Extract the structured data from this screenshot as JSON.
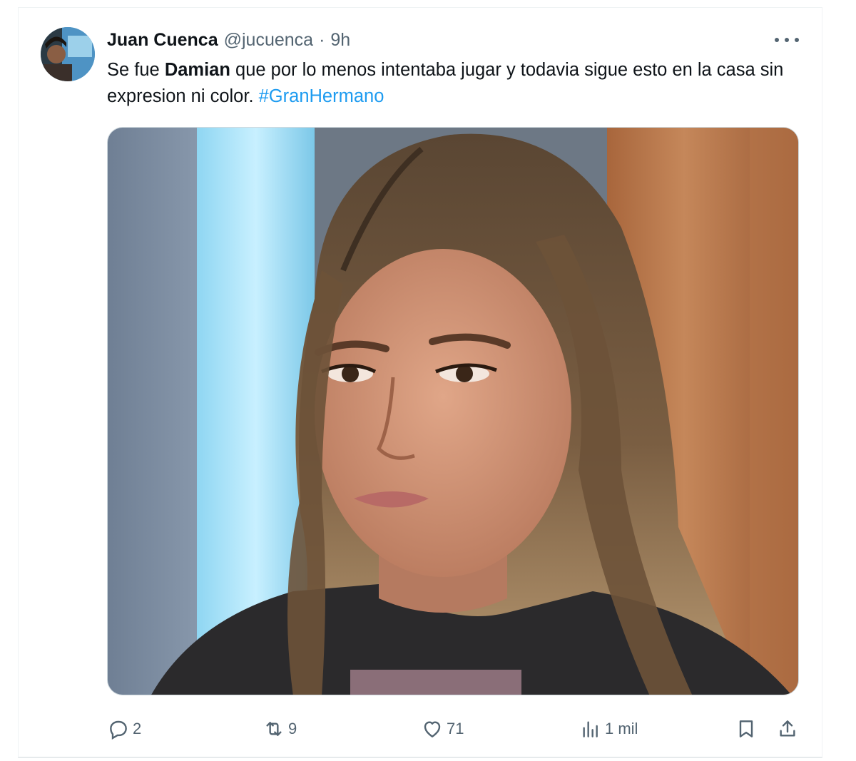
{
  "tweet": {
    "author_name": "Juan Cuenca",
    "handle": "@jucuenca",
    "separator": "·",
    "time": "9h",
    "text_part1": "Se fue ",
    "text_bold": "Damian",
    "text_part2": " que por lo menos intentaba jugar y todavia sigue esto en la casa sin expresion ni color. ",
    "hashtag": "#GranHermano",
    "media_icon": "photo-of-woman-icon"
  },
  "actions": {
    "replies": "2",
    "retweets": "9",
    "likes": "71",
    "views": "1 mil"
  },
  "icons": {
    "more": "more-dots-icon",
    "reply": "reply-icon",
    "retweet": "retweet-icon",
    "like": "heart-icon",
    "views": "views-chart-icon",
    "bookmark": "bookmark-icon",
    "share": "share-icon"
  },
  "colors": {
    "text": "#0f1419",
    "secondary": "#536471",
    "link": "#1d9bf0"
  }
}
